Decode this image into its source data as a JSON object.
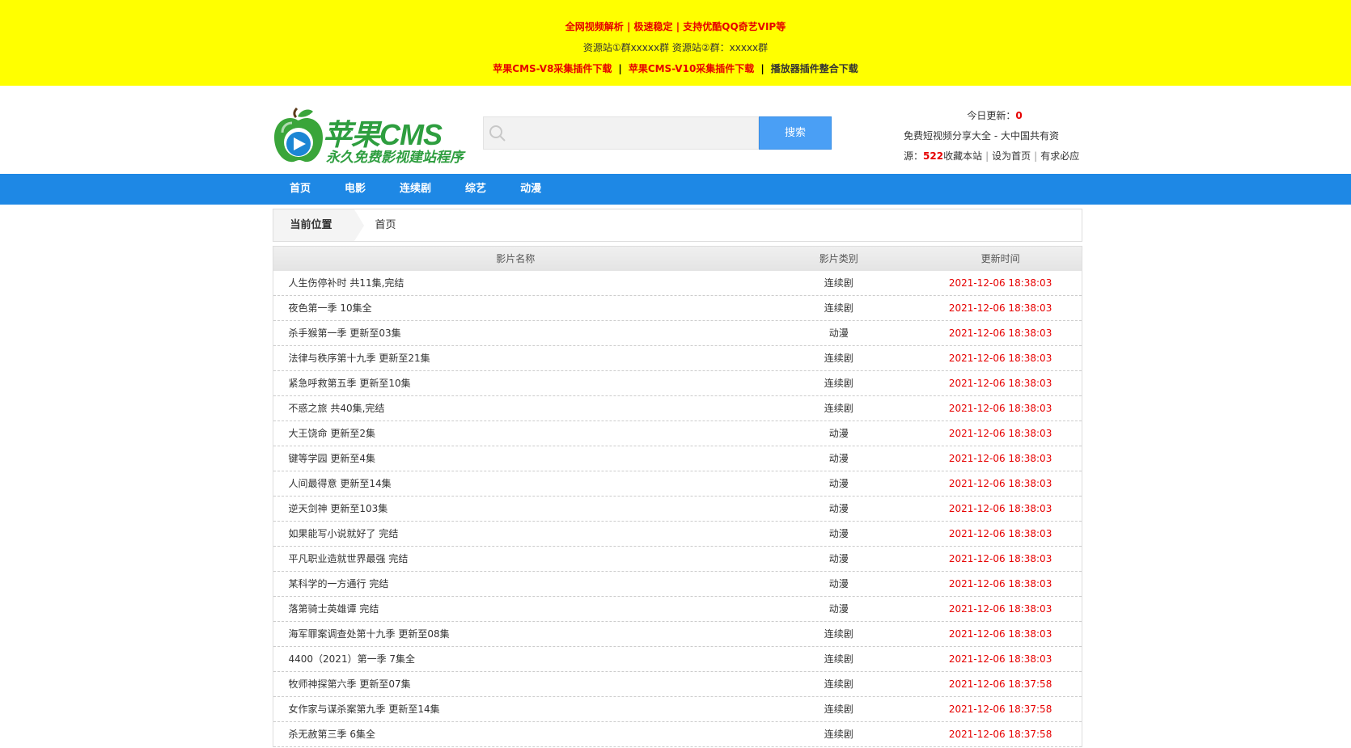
{
  "topbar": {
    "line1": "全网视频解析 | 极速稳定 | 支持优酷QQ奇艺VIP等",
    "line2": "资源站①群xxxxx群 资源站②群：xxxxx群",
    "links": [
      {
        "label": "苹果CMS-V8采集插件下载"
      },
      {
        "label": "苹果CMS-V10采集插件下载"
      },
      {
        "label": "播放器插件整合下载"
      }
    ],
    "separator": "|"
  },
  "logo": {
    "title": "苹果CMS",
    "subtitle": "永久免费影视建站程序",
    "colors": {
      "apple": "#3aa53a",
      "title": "#2e9e3f",
      "subtitle": "#2e9e3f",
      "play": "#1b86d4"
    }
  },
  "search": {
    "placeholder": "",
    "button_label": "搜索",
    "icon": "search-icon"
  },
  "info": {
    "today_label": "今日更新：",
    "today_count": "0",
    "desc_part1": "免费短视频分享大全 - 大中国共有资",
    "desc_part2": "源：",
    "total_count": "522",
    "links": [
      {
        "label": "收藏本站"
      },
      {
        "label": "设为首页"
      },
      {
        "label": "有求必应"
      }
    ]
  },
  "nav": {
    "items": [
      {
        "label": "首页"
      },
      {
        "label": "电影"
      },
      {
        "label": "连续剧"
      },
      {
        "label": "综艺"
      },
      {
        "label": "动漫"
      }
    ],
    "color": "#1e88e5"
  },
  "breadcrumb": {
    "label": "当前位置",
    "current": "首页"
  },
  "table": {
    "headers": {
      "name": "影片名称",
      "type": "影片类别",
      "time": "更新时间"
    },
    "rows": [
      {
        "name": "人生伤停补时 共11集,完结",
        "type": "连续剧",
        "time": "2021-12-06 18:38:03"
      },
      {
        "name": "夜色第一季 10集全",
        "type": "连续剧",
        "time": "2021-12-06 18:38:03"
      },
      {
        "name": "杀手猴第一季 更新至03集",
        "type": "动漫",
        "time": "2021-12-06 18:38:03"
      },
      {
        "name": "法律与秩序第十九季 更新至21集",
        "type": "连续剧",
        "time": "2021-12-06 18:38:03"
      },
      {
        "name": "紧急呼救第五季 更新至10集",
        "type": "连续剧",
        "time": "2021-12-06 18:38:03"
      },
      {
        "name": "不惑之旅 共40集,完结",
        "type": "连续剧",
        "time": "2021-12-06 18:38:03"
      },
      {
        "name": "大王饶命 更新至2集",
        "type": "动漫",
        "time": "2021-12-06 18:38:03"
      },
      {
        "name": "键等学园 更新至4集",
        "type": "动漫",
        "time": "2021-12-06 18:38:03"
      },
      {
        "name": "人间最得意 更新至14集",
        "type": "动漫",
        "time": "2021-12-06 18:38:03"
      },
      {
        "name": "逆天剑神 更新至103集",
        "type": "动漫",
        "time": "2021-12-06 18:38:03"
      },
      {
        "name": "如果能写小说就好了 完结",
        "type": "动漫",
        "time": "2021-12-06 18:38:03"
      },
      {
        "name": "平凡职业造就世界最强 完结",
        "type": "动漫",
        "time": "2021-12-06 18:38:03"
      },
      {
        "name": "某科学的一方通行 完结",
        "type": "动漫",
        "time": "2021-12-06 18:38:03"
      },
      {
        "name": "落第骑士英雄谭 完结",
        "type": "动漫",
        "time": "2021-12-06 18:38:03"
      },
      {
        "name": "海军罪案调查处第十九季 更新至08集",
        "type": "连续剧",
        "time": "2021-12-06 18:38:03"
      },
      {
        "name": "4400（2021）第一季 7集全",
        "type": "连续剧",
        "time": "2021-12-06 18:38:03"
      },
      {
        "name": "牧师神探第六季 更新至07集",
        "type": "连续剧",
        "time": "2021-12-06 18:37:58"
      },
      {
        "name": "女作家与谋杀案第九季 更新至14集",
        "type": "连续剧",
        "time": "2021-12-06 18:37:58"
      },
      {
        "name": "杀无赦第三季 6集全",
        "type": "连续剧",
        "time": "2021-12-06 18:37:58"
      }
    ]
  }
}
